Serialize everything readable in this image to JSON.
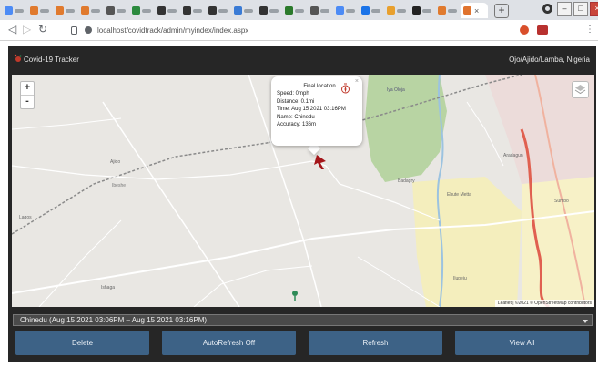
{
  "browser": {
    "address": "localhost/covidtrack/admin/myindex/index.aspx",
    "window_controls": [
      "–",
      "□",
      "×"
    ]
  },
  "app": {
    "brand": "Covid-19 Tracker",
    "location": "Ojo/Ajido/Lamba, Nigeria"
  },
  "map": {
    "zoom_in": "+",
    "zoom_out": "-",
    "popup": {
      "title": "Final location",
      "lines": [
        "Speed: 0mph",
        "Distance: 0.1mi",
        "Time: Aug 15 2021 03:16PM",
        "Name: Chinedu",
        "Accuracy: 136m"
      ]
    },
    "place_labels": [
      "Ajido",
      "Ibeshe",
      "Iya Oloja",
      "Lagos",
      "Ebute Metta",
      "Badagry",
      "Ishaga",
      "Aradagun",
      "Sumbo",
      "Ilupeju"
    ],
    "attribution": "Leaflet | ©2021 © OpenStreetMap contributors"
  },
  "selector": {
    "value": "Chinedu (Aug 15 2021 03:06PM – Aug 15 2021 03:16PM)"
  },
  "buttons": {
    "delete": "Delete",
    "autorefresh": "AutoRefresh Off",
    "refresh": "Refresh",
    "viewall": "View All"
  }
}
